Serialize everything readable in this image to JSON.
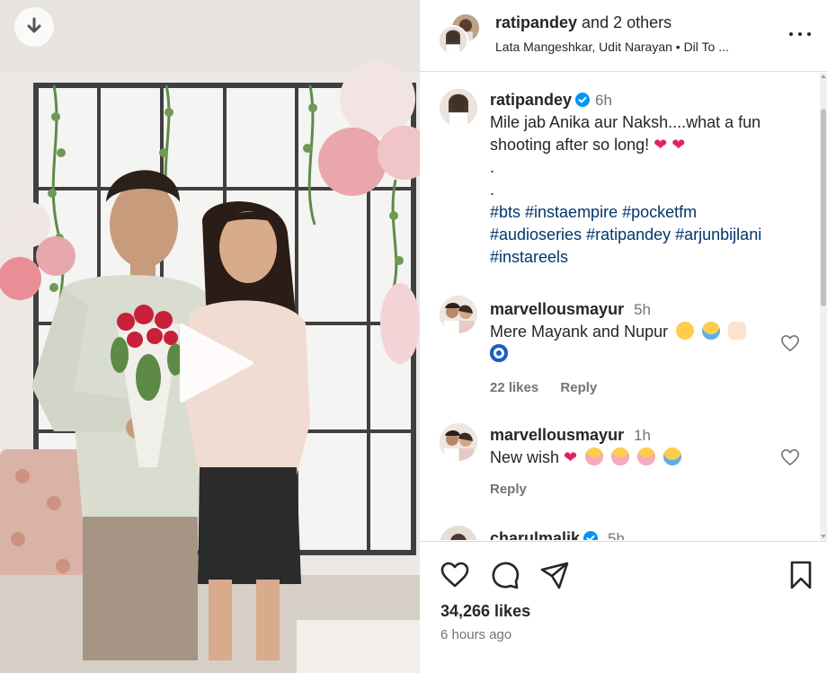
{
  "header": {
    "username": "ratipandey",
    "and_others": "and 2 others",
    "audio": "Lata Mangeshkar, Udit Narayan • Dil To ..."
  },
  "caption": {
    "username": "ratipandey",
    "time": "6h",
    "text": "Mile jab Anika aur Naksh....what a fun shooting after so long!",
    "dot1": ".",
    "dot2": ".",
    "hashtags_line1": "#bts #instaempire #pocketfm",
    "hashtags_line2": "#audioseries #ratipandey #arjunbijlani",
    "hashtags_line3": "#instareels"
  },
  "comments": [
    {
      "username": "marvellousmayur",
      "time": "5h",
      "text": "Mere Mayank and Nupur",
      "likes": "22 likes",
      "reply": "Reply"
    },
    {
      "username": "marvellousmayur",
      "time": "1h",
      "text": "New wish",
      "reply": "Reply"
    },
    {
      "username": "charulmalik",
      "time": "5h"
    }
  ],
  "footer": {
    "likes": "34,266 likes",
    "time_ago": "6 hours ago"
  },
  "icons": {
    "download": "download-icon",
    "play": "play-icon",
    "more": "more-options-icon",
    "heart": "heart-icon",
    "comment": "comment-icon",
    "share": "share-icon",
    "save": "bookmark-icon",
    "verified": "verified-badge-icon"
  },
  "colors": {
    "link": "#00376b",
    "verified": "#0095f6",
    "muted": "#737373",
    "text": "#262626"
  }
}
